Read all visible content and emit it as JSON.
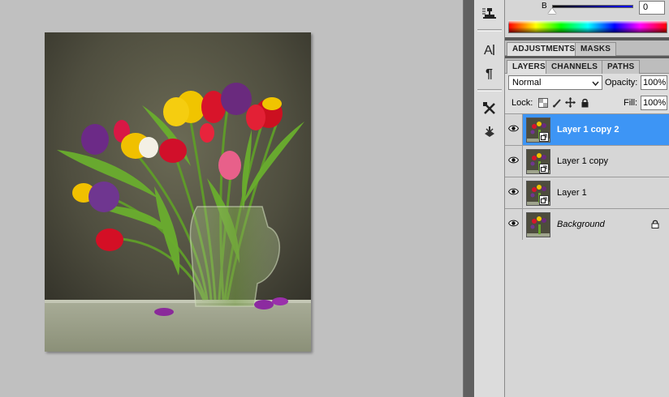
{
  "color_panel": {
    "channel_label": "B",
    "channel_value": "0"
  },
  "panel_group_1": {
    "tabs": [
      {
        "label": "ADJUSTMENTS",
        "active": true
      },
      {
        "label": "MASKS",
        "active": false
      }
    ]
  },
  "panel_group_2": {
    "tabs": [
      {
        "label": "LAYERS",
        "active": true
      },
      {
        "label": "CHANNELS",
        "active": false
      },
      {
        "label": "PATHS",
        "active": false
      }
    ]
  },
  "layers": {
    "blend_mode": "Normal",
    "opacity_label": "Opacity:",
    "opacity_value": "100%",
    "lock_label": "Lock:",
    "fill_label": "Fill:",
    "fill_value": "100%",
    "items": [
      {
        "name": "Layer 1 copy 2",
        "selected": true,
        "linked": true,
        "locked": false
      },
      {
        "name": "Layer 1 copy",
        "selected": false,
        "linked": true,
        "locked": false
      },
      {
        "name": "Layer 1",
        "selected": false,
        "linked": true,
        "locked": false
      },
      {
        "name": "Background",
        "selected": false,
        "linked": false,
        "locked": true
      }
    ]
  },
  "tool_dock": {
    "icons": [
      "clone-source-icon",
      "character-icon",
      "paragraph-icon",
      "tool-presets-icon",
      "brush-presets-icon"
    ]
  },
  "colors": {
    "selected_layer": "#3d95f5",
    "canvas_background": "#c0c0c0",
    "panel_background": "#d6d6d6"
  }
}
